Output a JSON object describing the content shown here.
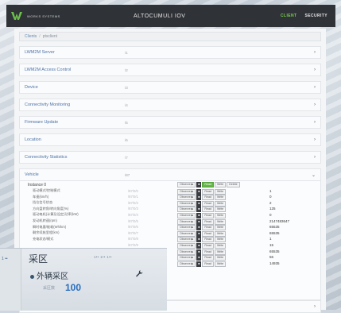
{
  "topbar": {
    "brand": "WORKS SYSTEMS",
    "title": "ALTOCUMULI IOV",
    "nav": [
      {
        "label": "CLIENT",
        "active": true
      },
      {
        "label": "SECURITY",
        "active": false
      }
    ]
  },
  "breadcrumb": {
    "root": "Clients",
    "separator": "/",
    "current": "ptsclient"
  },
  "objects": [
    {
      "name": "LWM2M Server",
      "oid": "/1"
    },
    {
      "name": "LWM2M Access Control",
      "oid": "/2"
    },
    {
      "name": "Device",
      "oid": "/3"
    },
    {
      "name": "Connectivity Monitoring",
      "oid": "/4"
    },
    {
      "name": "Firmware Update",
      "oid": "/5"
    },
    {
      "name": "Location",
      "oid": "/6"
    },
    {
      "name": "Connectivity Statistics",
      "oid": "/7"
    },
    {
      "name": "Vehicle",
      "oid": "/87"
    }
  ],
  "instance": {
    "label": "Instance 0",
    "buttons": {
      "observe": "Observe ▶",
      "stop": "■",
      "read": "Read",
      "write": "Write",
      "delete": "Delete"
    },
    "resources": [
      {
        "name": "驱动模式/控制模式",
        "id": "/87/0/0",
        "value": "1"
      },
      {
        "name": "车速(km/h)",
        "id": "/87/0/1",
        "value": "0"
      },
      {
        "name": "挡位信号状态",
        "id": "/87/0/2",
        "value": "2"
      },
      {
        "name": "方向盘转角/转向角度(%)",
        "id": "/87/0/3",
        "value": "125"
      },
      {
        "name": "驱动电机(计算及设定)功率(kW)",
        "id": "/87/0/4",
        "value": "0"
      },
      {
        "name": "发动机转速(rpm)",
        "id": "/87/0/5",
        "value": "2147483647"
      },
      {
        "name": "瞬时电量/能耗(Wh/km)",
        "id": "/87/0/6",
        "value": "65535"
      },
      {
        "name": "剩余续航里程(km)",
        "id": "/87/0/7",
        "value": "65535"
      },
      {
        "name": "充电状态/模式",
        "id": "/87/0/8",
        "value": "1"
      },
      {
        "name": "",
        "id": "/87/0/9",
        "value": "15"
      },
      {
        "name": "",
        "id": "/87/0/10",
        "value": "65535"
      },
      {
        "name": "",
        "id": "/87/0/11",
        "value": "56"
      },
      {
        "name": "",
        "id": "/87/0/12",
        "value": "14935"
      }
    ]
  },
  "photo": {
    "side_text": "1 ••",
    "title": "采区",
    "indicators": "1•• 1•• 1••",
    "sub": "外辆采区",
    "small": "采区数",
    "big": "100"
  },
  "colors": {
    "topbar_bg": "#2f3237",
    "active_nav": "#7bd14c",
    "link_blue": "#4d73a8",
    "read_green": "#64b946"
  }
}
